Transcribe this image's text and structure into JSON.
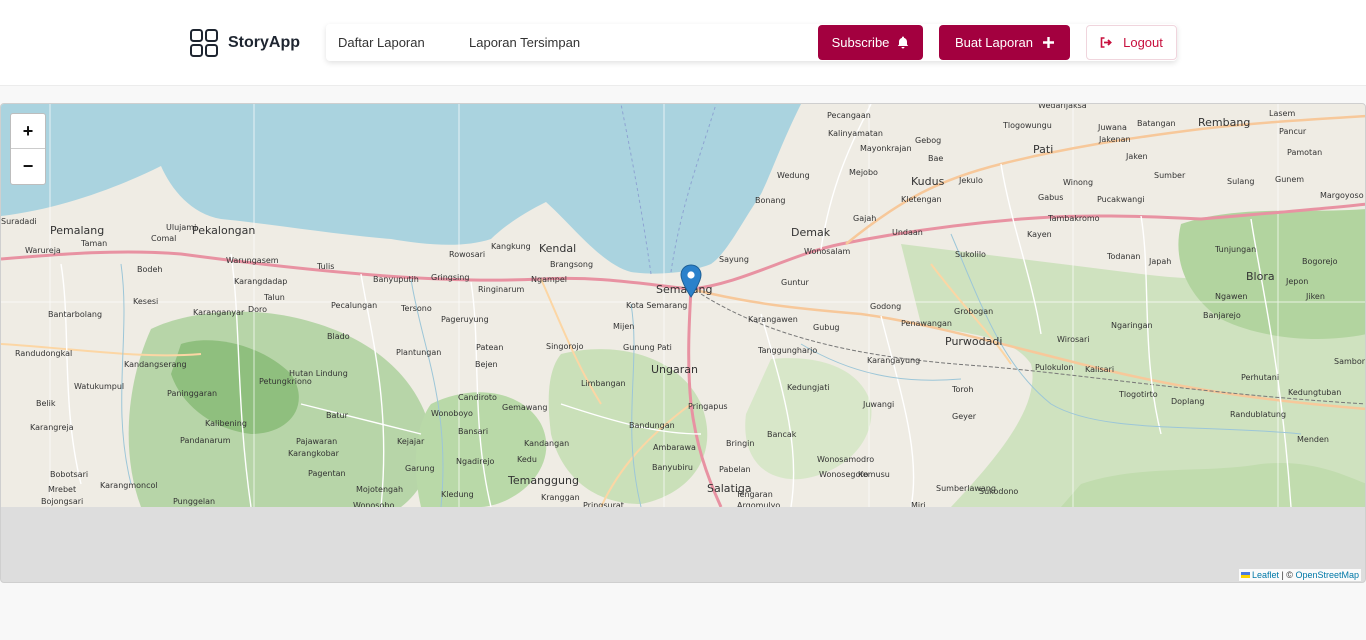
{
  "app": {
    "name": "StoryApp",
    "brand_icon": "grid-icon"
  },
  "nav": {
    "links": [
      "Daftar Laporan",
      "Laporan Tersimpan"
    ],
    "subscribe_label": "Subscribe",
    "subscribe_icon": "bell-icon",
    "new_report_label": "Buat Laporan",
    "new_report_icon": "plus-icon",
    "logout_label": "Logout",
    "logout_icon": "sign-out-icon"
  },
  "map": {
    "zoom_in": "+",
    "zoom_out": "−",
    "marker_icon": "map-marker-icon",
    "attribution": {
      "leaflet": "Leaflet",
      "separator": " | © ",
      "osm": "OpenStreetMap"
    },
    "place_labels": {
      "large": [
        "Pemalang",
        "Pekalongan",
        "Kendal",
        "Semarang",
        "Demak",
        "Kudus",
        "Pati",
        "Rembang",
        "Blora",
        "Purwodadi",
        "Ungaran",
        "Temanggung",
        "Salatiga"
      ],
      "small": [
        "Suradadi",
        "Warureja",
        "Taman",
        "Comal",
        "Ulujami",
        "Bodeh",
        "Warungasem",
        "Tulis",
        "Banyuputih",
        "Gringsing",
        "Rowosari",
        "Kangkung",
        "Brangsong",
        "Ringinarum",
        "Ngampel",
        "Kota Semarang",
        "Kesesi",
        "Bantarbolang",
        "Karangdadap",
        "Talun",
        "Karanganyar",
        "Doro",
        "Pecalungan",
        "Tersono",
        "Pageruyung",
        "Blado",
        "Plantungan",
        "Patean",
        "Singorojo",
        "Mijen",
        "Gunung Pati",
        "Bejen",
        "Randudongkal",
        "Kandangserang",
        "Petungkriono",
        "Hutan Lindung",
        "Watukumpul",
        "Paninggaran",
        "Limbangan",
        "Candiroto",
        "Gemawang",
        "Pringapus",
        "Bandungan",
        "Kandangan",
        "Kedu",
        "Ambarawa",
        "Banyubiru",
        "Bringin",
        "Pabelan",
        "Bancak",
        "Tengaran",
        "Argomulyo",
        "Wonosobo",
        "Kledung",
        "Kranggan",
        "Pringsurat",
        "Bobotsari",
        "Karangmoncol",
        "Mrebet",
        "Bojongsari",
        "Punggelan",
        "Pagentan",
        "Mojotengah",
        "Garung",
        "Ngadirejo",
        "Bansari",
        "Kejajar",
        "Pajawaran",
        "Karangkobar",
        "Kalibening",
        "Pandanarum",
        "Batur",
        "Wonoboyo",
        "Belik",
        "Karangreja",
        "Pecangaan",
        "Kalinyamatan",
        "Mayonkrajan",
        "Gebog",
        "Bae",
        "Jekulo",
        "Kletengan",
        "Mejobo",
        "Wedung",
        "Bonang",
        "Gajah",
        "Undaan",
        "Sayung",
        "Guntur",
        "Wonosalam",
        "Karangawen",
        "Gubug",
        "Tanggungharjo",
        "Kedungjati",
        "Godong",
        "Grobogan",
        "Penawangan",
        "Karangayung",
        "Toroh",
        "Geyer",
        "Juwangi",
        "Kemusu",
        "Wonosegoro",
        "Wonosamodro",
        "Sumberlawang",
        "Sukodono",
        "Miri",
        "Tlogowungu",
        "Wedarijaksa",
        "Juwana",
        "Batangan",
        "Lasem",
        "Pancur",
        "Pamotan",
        "Gunem",
        "Sulang",
        "Sumber",
        "Jaken",
        "Jakenan",
        "Winong",
        "Gabus",
        "Tambakromo",
        "Pucakwangi",
        "Kayen",
        "Sukolilo",
        "Todanan",
        "Japah",
        "Tunjungan",
        "Bogorejo",
        "Jepon",
        "Jiken",
        "Ngawen",
        "Banjarejo",
        "Ngaringan",
        "Wirosari",
        "Kalisari",
        "Pulokulon",
        "Tlogotirto",
        "Doplang",
        "Randublatung",
        "Kedungtuban",
        "Menden",
        "Sambong",
        "Perhutani",
        "Margoyoso"
      ]
    }
  }
}
